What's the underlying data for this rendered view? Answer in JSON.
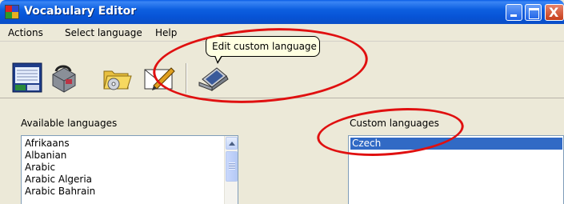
{
  "window": {
    "title": "Vocabulary Editor",
    "accent": "#0a5ee6",
    "close_glyph": "X"
  },
  "menu": {
    "items": [
      "Actions",
      "Select language",
      "Help"
    ]
  },
  "toolbar": {
    "buttons": [
      {
        "icon": "vocabulary-window-icon"
      },
      {
        "icon": "toolbox-icon"
      },
      {
        "icon": "folder-open-icon"
      },
      {
        "icon": "edit-envelope-icon"
      },
      {
        "icon": "laptop-icon"
      }
    ]
  },
  "tooltip": {
    "text": "Edit custom language"
  },
  "available": {
    "label": "Available languages",
    "items": [
      "Afrikaans",
      "Albanian",
      "Arabic",
      "Arabic Algeria",
      "Arabic Bahrain"
    ]
  },
  "custom": {
    "label": "Custom languages",
    "items": [
      "Czech"
    ],
    "selected_color": "#316ac5"
  },
  "annotation_color": "#e01010"
}
